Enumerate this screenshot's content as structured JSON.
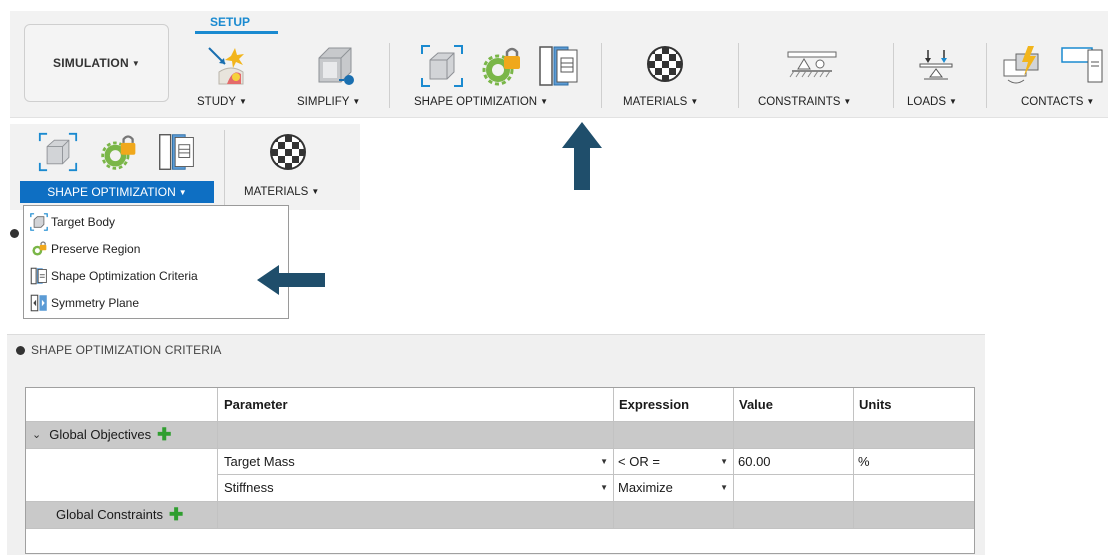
{
  "ribbon": {
    "workspace_button": "SIMULATION",
    "active_tab": "SETUP",
    "groups": [
      {
        "label": "STUDY",
        "icon": "study-icon"
      },
      {
        "label": "SIMPLIFY",
        "icon": "simplify-icon"
      },
      {
        "label": "SHAPE OPTIMIZATION",
        "icon": "shape-optimization-icons"
      },
      {
        "label": "MATERIALS",
        "icon": "materials-icon"
      },
      {
        "label": "CONSTRAINTS",
        "icon": "constraints-icon"
      },
      {
        "label": "LOADS",
        "icon": "loads-icon"
      },
      {
        "label": "CONTACTS",
        "icon": "contacts-icon"
      }
    ]
  },
  "expanded_ribbon": {
    "shape_optimization_label": "SHAPE OPTIMIZATION",
    "materials_label": "MATERIALS"
  },
  "menu": {
    "items": [
      {
        "label": "Target Body",
        "icon": "target-body-icon"
      },
      {
        "label": "Preserve Region",
        "icon": "preserve-region-icon"
      },
      {
        "label": "Shape Optimization Criteria",
        "icon": "criteria-icon"
      },
      {
        "label": "Symmetry Plane",
        "icon": "symmetry-plane-icon"
      }
    ]
  },
  "panel": {
    "title": "SHAPE OPTIMIZATION CRITERIA",
    "columns": [
      "Parameter",
      "Expression",
      "Value",
      "Units"
    ],
    "sections": [
      {
        "label": "Global Objectives"
      },
      {
        "label": "Global Constraints"
      }
    ],
    "rows": [
      {
        "parameter": "Target Mass",
        "expression": "< OR =",
        "value": "60.00",
        "units": "%"
      },
      {
        "parameter": "Stiffness",
        "expression": "Maximize",
        "value": "",
        "units": ""
      }
    ]
  },
  "colors": {
    "accent": "#1a8ad0",
    "selected_button": "#0e6fc3",
    "arrow": "#1f4e6b",
    "section_row": "#c9c9c9",
    "plus": "#2f9e2f"
  }
}
